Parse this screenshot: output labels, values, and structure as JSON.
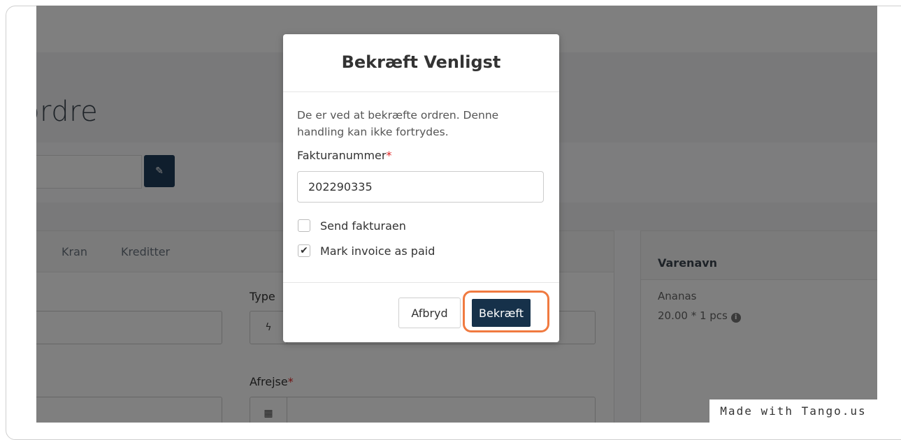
{
  "page": {
    "title_fragment": "ordre",
    "tabs": [
      "Kran",
      "Kreditter"
    ],
    "type_label": "Type",
    "afrejse_label": "Afrejse",
    "required_mark": "*",
    "type_icon": "bolt-icon",
    "calendar_icon": "calendar-icon"
  },
  "side_card": {
    "header": "Varenavn",
    "product_name": "Ananas",
    "product_qty": "20.00 * 1 pcs"
  },
  "modal": {
    "title": "Bekræft Venligst",
    "message": "De er ved at bekræfte ordren. Denne handling kan ikke fortrydes.",
    "invoice_label": "Fakturanummer",
    "required_mark": "*",
    "invoice_value": "202290335",
    "checkboxes": [
      {
        "label": "Send fakturaen",
        "checked": false
      },
      {
        "label": "Mark invoice as paid",
        "checked": true
      }
    ],
    "cancel_label": "Afbryd",
    "confirm_label": "Bekræft"
  },
  "watermark": "Made with Tango.us",
  "colors": {
    "confirm_button": "#16314a",
    "highlight": "#f07a40",
    "required": "#e02424",
    "edit_button": "#1f3d5a"
  }
}
